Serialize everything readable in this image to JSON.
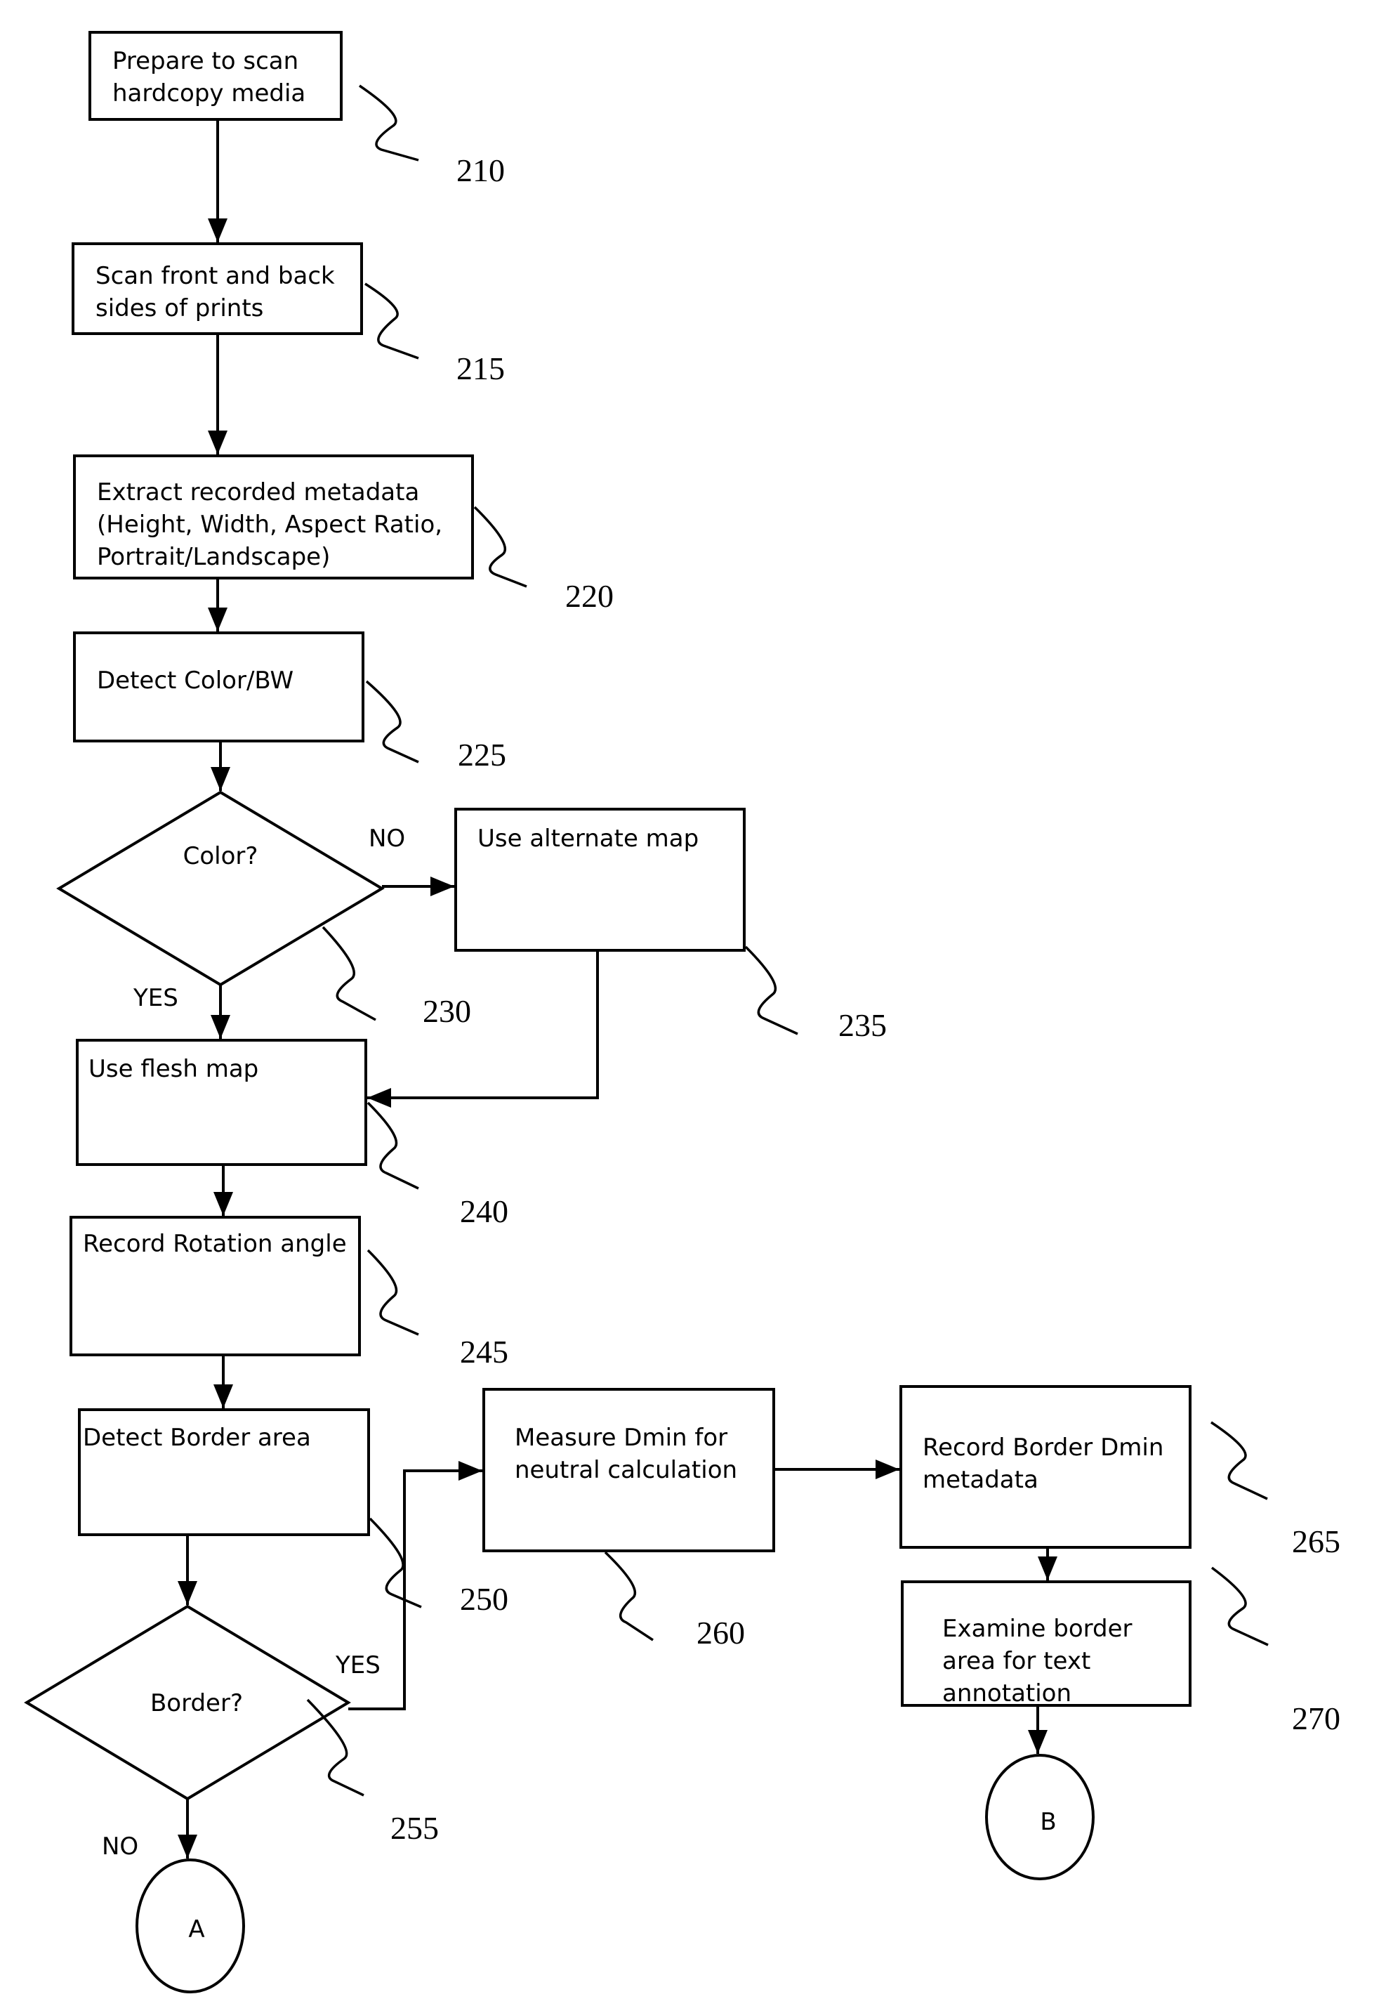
{
  "figure": {
    "type": "flowchart",
    "nodes": [
      {
        "id": "210",
        "shape": "process",
        "lines": [
          "Prepare to scan",
          "hardcopy media"
        ],
        "ref": "210"
      },
      {
        "id": "215",
        "shape": "process",
        "lines": [
          "Scan front and back",
          "sides of prints"
        ],
        "ref": "215"
      },
      {
        "id": "220",
        "shape": "process",
        "lines": [
          "Extract recorded metadata",
          "(Height, Width, Aspect Ratio,",
          "Portrait/Landscape)"
        ],
        "ref": "220"
      },
      {
        "id": "225",
        "shape": "process",
        "lines": [
          "Detect Color/BW"
        ],
        "ref": "225"
      },
      {
        "id": "230",
        "shape": "decision",
        "lines": [
          "Color?"
        ],
        "ref": "230"
      },
      {
        "id": "235",
        "shape": "process",
        "lines": [
          "Use alternate map"
        ],
        "ref": "235"
      },
      {
        "id": "240",
        "shape": "process",
        "lines": [
          "Use flesh map"
        ],
        "ref": "240"
      },
      {
        "id": "245",
        "shape": "process",
        "lines": [
          "Record Rotation angle"
        ],
        "ref": "245"
      },
      {
        "id": "250",
        "shape": "process",
        "lines": [
          "Detect Border area"
        ],
        "ref": "250"
      },
      {
        "id": "255",
        "shape": "decision",
        "lines": [
          "Border?"
        ],
        "ref": "255"
      },
      {
        "id": "260",
        "shape": "process",
        "lines": [
          "Measure Dmin for",
          "neutral calculation"
        ],
        "ref": "260"
      },
      {
        "id": "265",
        "shape": "process",
        "lines": [
          "Record Border Dmin",
          "metadata"
        ],
        "ref": "265"
      },
      {
        "id": "270",
        "shape": "process",
        "lines": [
          "Examine border",
          "area for text",
          "annotation"
        ],
        "ref": "270"
      },
      {
        "id": "A",
        "shape": "connector",
        "lines": [
          "A"
        ]
      },
      {
        "id": "B",
        "shape": "connector",
        "lines": [
          "B"
        ]
      }
    ],
    "edges": [
      {
        "from": "210",
        "to": "215",
        "label": ""
      },
      {
        "from": "215",
        "to": "220",
        "label": ""
      },
      {
        "from": "220",
        "to": "225",
        "label": ""
      },
      {
        "from": "225",
        "to": "230",
        "label": ""
      },
      {
        "from": "230",
        "to": "235",
        "label": "NO"
      },
      {
        "from": "230",
        "to": "240",
        "label": "YES"
      },
      {
        "from": "235",
        "to": "240",
        "label": ""
      },
      {
        "from": "240",
        "to": "245",
        "label": ""
      },
      {
        "from": "245",
        "to": "250",
        "label": ""
      },
      {
        "from": "250",
        "to": "255",
        "label": ""
      },
      {
        "from": "255",
        "to": "260",
        "label": "YES"
      },
      {
        "from": "255",
        "to": "A",
        "label": "NO"
      },
      {
        "from": "260",
        "to": "265",
        "label": ""
      },
      {
        "from": "265",
        "to": "270",
        "label": ""
      },
      {
        "from": "270",
        "to": "B",
        "label": ""
      }
    ]
  }
}
